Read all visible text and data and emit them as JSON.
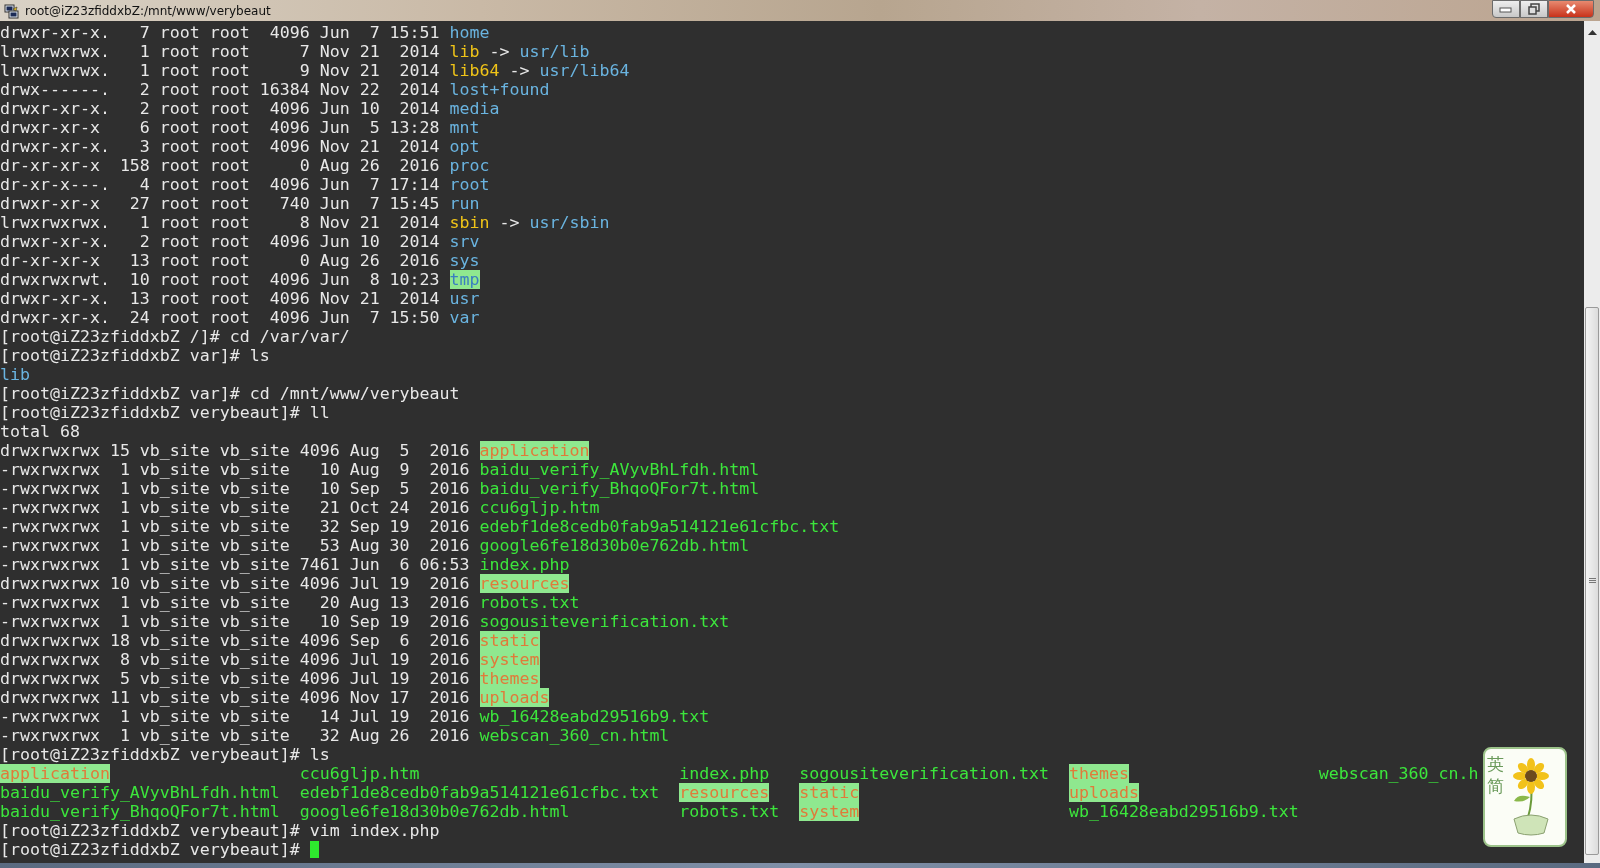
{
  "window": {
    "title": "root@iZ23zfiddxbZ:/mnt/www/verybeaut"
  },
  "terminal": {
    "lines": [
      {
        "kind": "text",
        "segments": [
          {
            "text": "drwxr-xr-x.   7 root root  4096 Jun  7 15:51 ",
            "kind": "plain"
          },
          {
            "text": "home",
            "kind": "dir"
          }
        ]
      },
      {
        "kind": "text",
        "segments": [
          {
            "text": "lrwxrwxrwx.   1 root root     7 Nov 21  2014 ",
            "kind": "plain"
          },
          {
            "text": "lib",
            "kind": "symlink"
          },
          {
            "text": " -> ",
            "kind": "plain"
          },
          {
            "text": "usr/lib",
            "kind": "dir"
          }
        ]
      },
      {
        "kind": "text",
        "segments": [
          {
            "text": "lrwxrwxrwx.   1 root root     9 Nov 21  2014 ",
            "kind": "plain"
          },
          {
            "text": "lib64",
            "kind": "symlink"
          },
          {
            "text": " -> ",
            "kind": "plain"
          },
          {
            "text": "usr/lib64",
            "kind": "dir"
          }
        ]
      },
      {
        "kind": "text",
        "segments": [
          {
            "text": "drwx------.   2 root root 16384 Nov 22  2014 ",
            "kind": "plain"
          },
          {
            "text": "lost+found",
            "kind": "dir"
          }
        ]
      },
      {
        "kind": "text",
        "segments": [
          {
            "text": "drwxr-xr-x.   2 root root  4096 Jun 10  2014 ",
            "kind": "plain"
          },
          {
            "text": "media",
            "kind": "dir"
          }
        ]
      },
      {
        "kind": "text",
        "segments": [
          {
            "text": "drwxr-xr-x    6 root root  4096 Jun  5 13:28 ",
            "kind": "plain"
          },
          {
            "text": "mnt",
            "kind": "dir"
          }
        ]
      },
      {
        "kind": "text",
        "segments": [
          {
            "text": "drwxr-xr-x.   3 root root  4096 Nov 21  2014 ",
            "kind": "plain"
          },
          {
            "text": "opt",
            "kind": "dir"
          }
        ]
      },
      {
        "kind": "text",
        "segments": [
          {
            "text": "dr-xr-xr-x  158 root root     0 Aug 26  2016 ",
            "kind": "plain"
          },
          {
            "text": "proc",
            "kind": "dir"
          }
        ]
      },
      {
        "kind": "text",
        "segments": [
          {
            "text": "dr-xr-x---.   4 root root  4096 Jun  7 17:14 ",
            "kind": "plain"
          },
          {
            "text": "root",
            "kind": "dir"
          }
        ]
      },
      {
        "kind": "text",
        "segments": [
          {
            "text": "drwxr-xr-x   27 root root   740 Jun  7 15:45 ",
            "kind": "plain"
          },
          {
            "text": "run",
            "kind": "dir"
          }
        ]
      },
      {
        "kind": "text",
        "segments": [
          {
            "text": "lrwxrwxrwx.   1 root root     8 Nov 21  2014 ",
            "kind": "plain"
          },
          {
            "text": "sbin",
            "kind": "symlink"
          },
          {
            "text": " -> ",
            "kind": "plain"
          },
          {
            "text": "usr/sbin",
            "kind": "dir"
          }
        ]
      },
      {
        "kind": "text",
        "segments": [
          {
            "text": "drwxr-xr-x.   2 root root  4096 Jun 10  2014 ",
            "kind": "plain"
          },
          {
            "text": "srv",
            "kind": "dir"
          }
        ]
      },
      {
        "kind": "text",
        "segments": [
          {
            "text": "dr-xr-xr-x   13 root root     0 Aug 26  2016 ",
            "kind": "plain"
          },
          {
            "text": "sys",
            "kind": "dir"
          }
        ]
      },
      {
        "kind": "text",
        "segments": [
          {
            "text": "drwxrwxrwt.  10 root root  4096 Jun  8 10:23 ",
            "kind": "plain"
          },
          {
            "text": "tmp",
            "kind": "sticky"
          }
        ]
      },
      {
        "kind": "text",
        "segments": [
          {
            "text": "drwxr-xr-x.  13 root root  4096 Nov 21  2014 ",
            "kind": "plain"
          },
          {
            "text": "usr",
            "kind": "dir"
          }
        ]
      },
      {
        "kind": "text",
        "segments": [
          {
            "text": "drwxr-xr-x.  24 root root  4096 Jun  7 15:50 ",
            "kind": "plain"
          },
          {
            "text": "var",
            "kind": "dir"
          }
        ]
      },
      {
        "kind": "text",
        "segments": [
          {
            "text": "[root@iZ23zfiddxbZ /]# cd /var/var/",
            "kind": "plain"
          }
        ]
      },
      {
        "kind": "text",
        "segments": [
          {
            "text": "[root@iZ23zfiddxbZ var]# ls",
            "kind": "plain"
          }
        ]
      },
      {
        "kind": "text",
        "segments": [
          {
            "text": "lib",
            "kind": "dir"
          }
        ]
      },
      {
        "kind": "text",
        "segments": [
          {
            "text": "[root@iZ23zfiddxbZ var]# cd /mnt/www/verybeaut",
            "kind": "plain"
          }
        ]
      },
      {
        "kind": "text",
        "segments": [
          {
            "text": "[root@iZ23zfiddxbZ verybeaut]# ll",
            "kind": "plain"
          }
        ]
      },
      {
        "kind": "text",
        "segments": [
          {
            "text": "total 68",
            "kind": "plain"
          }
        ]
      },
      {
        "kind": "text",
        "segments": [
          {
            "text": "drwxrwxrwx 15 vb_site vb_site 4096 Aug  5  2016 ",
            "kind": "plain"
          },
          {
            "text": "application",
            "kind": "otherw"
          }
        ]
      },
      {
        "kind": "text",
        "segments": [
          {
            "text": "-rwxrwxrwx  1 vb_site vb_site   10 Aug  9  2016 ",
            "kind": "plain"
          },
          {
            "text": "baidu_verify_AVyvBhLfdh.html",
            "kind": "exec"
          }
        ]
      },
      {
        "kind": "text",
        "segments": [
          {
            "text": "-rwxrwxrwx  1 vb_site vb_site   10 Sep  5  2016 ",
            "kind": "plain"
          },
          {
            "text": "baidu_verify_BhqoQFor7t.html",
            "kind": "exec"
          }
        ]
      },
      {
        "kind": "text",
        "segments": [
          {
            "text": "-rwxrwxrwx  1 vb_site vb_site   21 Oct 24  2016 ",
            "kind": "plain"
          },
          {
            "text": "ccu6gljp.htm",
            "kind": "exec"
          }
        ]
      },
      {
        "kind": "text",
        "segments": [
          {
            "text": "-rwxrwxrwx  1 vb_site vb_site   32 Sep 19  2016 ",
            "kind": "plain"
          },
          {
            "text": "edebf1de8cedb0fab9a514121e61cfbc.txt",
            "kind": "exec"
          }
        ]
      },
      {
        "kind": "text",
        "segments": [
          {
            "text": "-rwxrwxrwx  1 vb_site vb_site   53 Aug 30  2016 ",
            "kind": "plain"
          },
          {
            "text": "google6fe18d30b0e762db.html",
            "kind": "exec"
          }
        ]
      },
      {
        "kind": "text",
        "segments": [
          {
            "text": "-rwxrwxrwx  1 vb_site vb_site 7461 Jun  6 06:53 ",
            "kind": "plain"
          },
          {
            "text": "index.php",
            "kind": "exec"
          }
        ]
      },
      {
        "kind": "text",
        "segments": [
          {
            "text": "drwxrwxrwx 10 vb_site vb_site 4096 Jul 19  2016 ",
            "kind": "plain"
          },
          {
            "text": "resources",
            "kind": "otherw"
          }
        ]
      },
      {
        "kind": "text",
        "segments": [
          {
            "text": "-rwxrwxrwx  1 vb_site vb_site   20 Aug 13  2016 ",
            "kind": "plain"
          },
          {
            "text": "robots.txt",
            "kind": "exec"
          }
        ]
      },
      {
        "kind": "text",
        "segments": [
          {
            "text": "-rwxrwxrwx  1 vb_site vb_site   10 Sep 19  2016 ",
            "kind": "plain"
          },
          {
            "text": "sogousiteverification.txt",
            "kind": "exec"
          }
        ]
      },
      {
        "kind": "text",
        "segments": [
          {
            "text": "drwxrwxrwx 18 vb_site vb_site 4096 Sep  6  2016 ",
            "kind": "plain"
          },
          {
            "text": "static",
            "kind": "otherw"
          }
        ]
      },
      {
        "kind": "text",
        "segments": [
          {
            "text": "drwxrwxrwx  8 vb_site vb_site 4096 Jul 19  2016 ",
            "kind": "plain"
          },
          {
            "text": "system",
            "kind": "otherw"
          }
        ]
      },
      {
        "kind": "text",
        "segments": [
          {
            "text": "drwxrwxrwx  5 vb_site vb_site 4096 Jul 19  2016 ",
            "kind": "plain"
          },
          {
            "text": "themes",
            "kind": "otherw"
          }
        ]
      },
      {
        "kind": "text",
        "segments": [
          {
            "text": "drwxrwxrwx 11 vb_site vb_site 4096 Nov 17  2016 ",
            "kind": "plain"
          },
          {
            "text": "uploads",
            "kind": "otherw"
          }
        ]
      },
      {
        "kind": "text",
        "segments": [
          {
            "text": "-rwxrwxrwx  1 vb_site vb_site   14 Jul 19  2016 ",
            "kind": "plain"
          },
          {
            "text": "wb_16428eabd29516b9.txt",
            "kind": "exec"
          }
        ]
      },
      {
        "kind": "text",
        "segments": [
          {
            "text": "-rwxrwxrwx  1 vb_site vb_site   32 Aug 26  2016 ",
            "kind": "plain"
          },
          {
            "text": "webscan_360_cn.html",
            "kind": "exec"
          }
        ]
      },
      {
        "kind": "text",
        "segments": [
          {
            "text": "[root@iZ23zfiddxbZ verybeaut]# ls",
            "kind": "plain"
          }
        ]
      },
      {
        "kind": "columns",
        "items": [
          {
            "text": "application",
            "kind": "otherw"
          },
          {
            "text": "baidu_verify_AVyvBhLfdh.html",
            "kind": "exec"
          },
          {
            "text": "baidu_verify_BhqoQFor7t.html",
            "kind": "exec"
          },
          {
            "text": "ccu6gljp.htm",
            "kind": "exec"
          },
          {
            "text": "edebf1de8cedb0fab9a514121e61cfbc.txt",
            "kind": "exec"
          },
          {
            "text": "google6fe18d30b0e762db.html",
            "kind": "exec"
          },
          {
            "text": "index.php",
            "kind": "exec"
          },
          {
            "text": "resources",
            "kind": "otherw"
          },
          {
            "text": "robots.txt",
            "kind": "exec"
          },
          {
            "text": "sogousiteverification.txt",
            "kind": "exec"
          },
          {
            "text": "static",
            "kind": "otherw"
          },
          {
            "text": "system",
            "kind": "otherw"
          },
          {
            "text": "themes",
            "kind": "otherw"
          },
          {
            "text": "uploads",
            "kind": "otherw"
          },
          {
            "text": "wb_16428eabd29516b9.txt",
            "kind": "exec"
          },
          {
            "text": "webscan_360_cn.h",
            "kind": "exec"
          }
        ]
      },
      {
        "kind": "text",
        "segments": [
          {
            "text": "[root@iZ23zfiddxbZ verybeaut]# vim index.php",
            "kind": "plain"
          }
        ]
      },
      {
        "kind": "text",
        "segments": [
          {
            "text": "[root@iZ23zfiddxbZ verybeaut]# ",
            "kind": "plain"
          },
          {
            "kind": "cursor"
          }
        ]
      }
    ]
  },
  "ime_widget": {
    "labels": [
      "英",
      "简"
    ]
  }
}
